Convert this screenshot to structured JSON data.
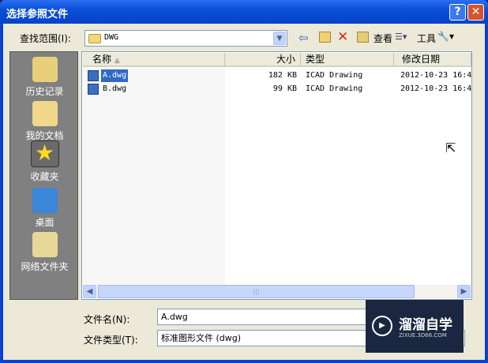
{
  "title": "选择参照文件",
  "title_buttons": {
    "help": "?",
    "close": "✕"
  },
  "look_in": {
    "label": "查找范围(I):",
    "value": "DWG"
  },
  "toolbar": {
    "view_label": "查看",
    "tools_label": "工具"
  },
  "places": [
    {
      "label": "历史记录",
      "icon": "history-icon"
    },
    {
      "label": "我的文档",
      "icon": "documents-icon"
    },
    {
      "label": "收藏夹",
      "icon": "favorites-icon"
    },
    {
      "label": "桌面",
      "icon": "desktop-icon"
    },
    {
      "label": "网络文件夹",
      "icon": "network-icon"
    }
  ],
  "columns": [
    "名称",
    "大小",
    "类型",
    "修改日期"
  ],
  "files": [
    {
      "name": "A.dwg",
      "size": "182 KB",
      "type": "ICAD Drawing",
      "modified": "2012-10-23 16:4",
      "selected": true
    },
    {
      "name": "B.dwg",
      "size": "99 KB",
      "type": "ICAD Drawing",
      "modified": "2012-10-23 16:4",
      "selected": false
    }
  ],
  "filename": {
    "label": "文件名(N):",
    "value": "A.dwg"
  },
  "filetype": {
    "label": "文件类型(T):",
    "value": "标准图形文件 (dwg)"
  },
  "watermark": {
    "brand": "溜溜自学",
    "url": "ZIXUE.3D66.COM"
  },
  "colors": {
    "titlebar": "#0a4fd8",
    "dialog": "#ece9d8",
    "selection": "#316ac5"
  }
}
